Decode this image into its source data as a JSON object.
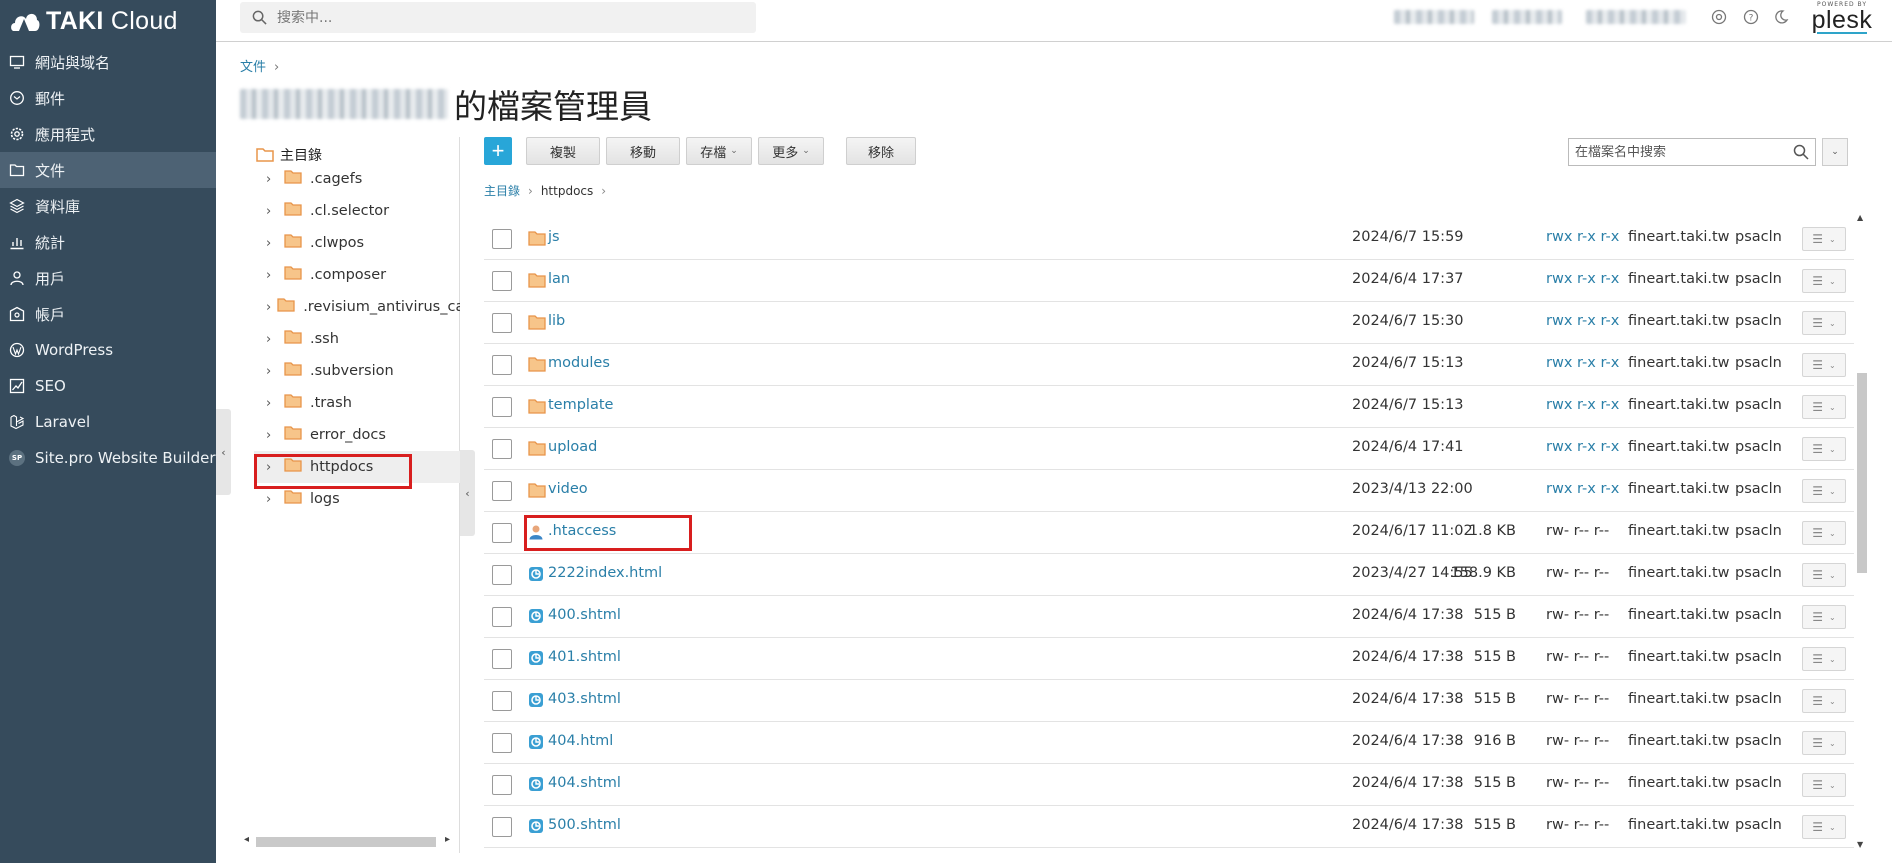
{
  "sidebar": {
    "logo_text_bold": "TAKI",
    "logo_text_light": " Cloud",
    "items": [
      {
        "label": "網站與域名",
        "icon": "monitor-icon"
      },
      {
        "label": "郵件",
        "icon": "mail-icon"
      },
      {
        "label": "應用程式",
        "icon": "gear-icon"
      },
      {
        "label": "文件",
        "icon": "folder-icon",
        "active": true
      },
      {
        "label": "資料庫",
        "icon": "database-icon"
      },
      {
        "label": "統計",
        "icon": "bar-chart-icon"
      },
      {
        "label": "用戶",
        "icon": "user-icon"
      },
      {
        "label": "帳戶",
        "icon": "account-icon"
      },
      {
        "label": "WordPress",
        "icon": "wordpress-icon"
      },
      {
        "label": "SEO",
        "icon": "seo-chart-icon"
      },
      {
        "label": "Laravel",
        "icon": "laravel-icon"
      },
      {
        "label": "Site.pro Website Builder",
        "icon": "sitepro-icon",
        "badge": "SP"
      }
    ]
  },
  "header": {
    "search_placeholder": "搜索中...",
    "powered_by": "POWERED BY",
    "brand": "plesk"
  },
  "breadcrumb": {
    "root": "文件"
  },
  "page_title_suffix": "的檔案管理員",
  "tree": {
    "root_label": "主目錄",
    "items": [
      {
        "label": ".cagefs"
      },
      {
        "label": ".cl.selector"
      },
      {
        "label": ".clwpos"
      },
      {
        "label": ".composer"
      },
      {
        "label": ".revisium_antivirus_cache"
      },
      {
        "label": ".ssh"
      },
      {
        "label": ".subversion"
      },
      {
        "label": ".trash"
      },
      {
        "label": "error_docs"
      },
      {
        "label": "httpdocs",
        "selected": true
      },
      {
        "label": "logs"
      }
    ]
  },
  "toolbar": {
    "add": "+",
    "copy": "複製",
    "move": "移動",
    "archive": "存檔",
    "more": "更多",
    "remove": "移除",
    "file_search_placeholder": "在檔案名中搜索"
  },
  "path": {
    "root": "主目錄",
    "current": "httpdocs"
  },
  "files": [
    {
      "name": "js",
      "type": "folder",
      "date": "2024/6/7 15:59",
      "size": "",
      "perms": "rwx r-x r-x",
      "owner": "fineart.taki.tw",
      "group": "psacln"
    },
    {
      "name": "lan",
      "type": "folder",
      "date": "2024/6/4 17:37",
      "size": "",
      "perms": "rwx r-x r-x",
      "owner": "fineart.taki.tw",
      "group": "psacln"
    },
    {
      "name": "lib",
      "type": "folder",
      "date": "2024/6/7 15:30",
      "size": "",
      "perms": "rwx r-x r-x",
      "owner": "fineart.taki.tw",
      "group": "psacln"
    },
    {
      "name": "modules",
      "type": "folder",
      "date": "2024/6/7 15:13",
      "size": "",
      "perms": "rwx r-x r-x",
      "owner": "fineart.taki.tw",
      "group": "psacln"
    },
    {
      "name": "template",
      "type": "folder",
      "date": "2024/6/7 15:13",
      "size": "",
      "perms": "rwx r-x r-x",
      "owner": "fineart.taki.tw",
      "group": "psacln"
    },
    {
      "name": "upload",
      "type": "folder",
      "date": "2024/6/4 17:41",
      "size": "",
      "perms": "rwx r-x r-x",
      "owner": "fineart.taki.tw",
      "group": "psacln"
    },
    {
      "name": "video",
      "type": "folder",
      "date": "2023/4/13 22:00",
      "size": "",
      "perms": "rwx r-x r-x",
      "owner": "fineart.taki.tw",
      "group": "psacln"
    },
    {
      "name": ".htaccess",
      "type": "htaccess",
      "date": "2024/6/17 11:02",
      "size": "1.8 KB",
      "perms": "rw- r-- r--",
      "owner": "fineart.taki.tw",
      "group": "psacln"
    },
    {
      "name": "2222index.html",
      "type": "html",
      "date": "2023/4/27 14:55",
      "size": "158.9 KB",
      "perms": "rw- r-- r--",
      "owner": "fineart.taki.tw",
      "group": "psacln"
    },
    {
      "name": "400.shtml",
      "type": "html",
      "date": "2024/6/4 17:38",
      "size": "515 B",
      "perms": "rw- r-- r--",
      "owner": "fineart.taki.tw",
      "group": "psacln"
    },
    {
      "name": "401.shtml",
      "type": "html",
      "date": "2024/6/4 17:38",
      "size": "515 B",
      "perms": "rw- r-- r--",
      "owner": "fineart.taki.tw",
      "group": "psacln"
    },
    {
      "name": "403.shtml",
      "type": "html",
      "date": "2024/6/4 17:38",
      "size": "515 B",
      "perms": "rw- r-- r--",
      "owner": "fineart.taki.tw",
      "group": "psacln"
    },
    {
      "name": "404.html",
      "type": "html",
      "date": "2024/6/4 17:38",
      "size": "916 B",
      "perms": "rw- r-- r--",
      "owner": "fineart.taki.tw",
      "group": "psacln"
    },
    {
      "name": "404.shtml",
      "type": "html",
      "date": "2024/6/4 17:38",
      "size": "515 B",
      "perms": "rw- r-- r--",
      "owner": "fineart.taki.tw",
      "group": "psacln"
    },
    {
      "name": "500.shtml",
      "type": "html",
      "date": "2024/6/4 17:38",
      "size": "515 B",
      "perms": "rw- r-- r--",
      "owner": "fineart.taki.tw",
      "group": "psacln"
    }
  ],
  "colors": {
    "sidebar_bg": "#364b5c",
    "link": "#2a7fa8",
    "accent": "#28a6d8",
    "highlight": "#d81e1e",
    "folder": "#f0a95a"
  }
}
